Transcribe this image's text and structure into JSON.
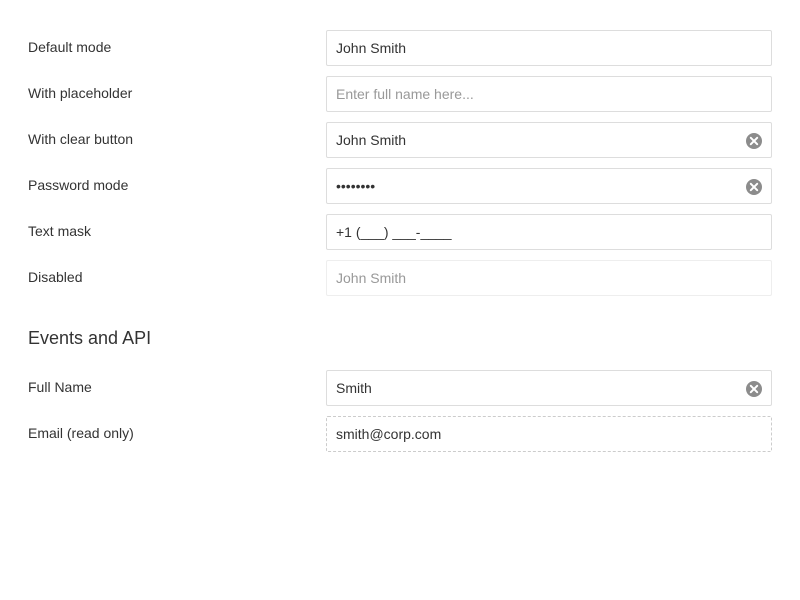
{
  "basic": {
    "default": {
      "label": "Default mode",
      "value": "John Smith"
    },
    "placeholder": {
      "label": "With placeholder",
      "value": "",
      "placeholder": "Enter full name here..."
    },
    "clear": {
      "label": "With clear button",
      "value": "John Smith"
    },
    "password": {
      "label": "Password mode",
      "value": "password"
    },
    "mask": {
      "label": "Text mask",
      "value": "+1 (___) ___-____"
    },
    "disabled": {
      "label": "Disabled",
      "value": "John Smith"
    }
  },
  "events": {
    "title": "Events and API",
    "full_name": {
      "label": "Full Name",
      "value": "Smith"
    },
    "email": {
      "label": "Email (read only)",
      "value": "smith@corp.com"
    }
  },
  "icons": {
    "clear": "clear-circle-icon"
  }
}
